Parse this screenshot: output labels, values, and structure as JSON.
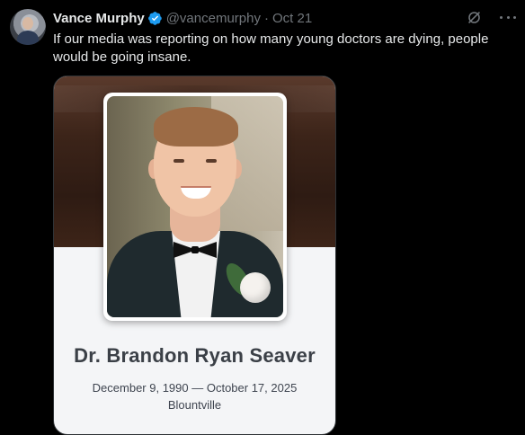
{
  "tweet": {
    "author_name": "Vance Murphy",
    "handle": "@vancemurphy",
    "separator": "·",
    "time": "Oct 21",
    "text": "If our media was reporting on how many young doctors are dying, people would be going insane.",
    "verified_icon": "verified-badge-icon",
    "grok_icon": "grok-icon",
    "more_icon": "more-options-icon"
  },
  "media": {
    "name": "Dr. Brandon Ryan Seaver",
    "dates": "December 9, 1990 — October 17, 2025",
    "place": "Blountville"
  },
  "colors": {
    "background": "#000000",
    "text": "#e7e9ea",
    "muted": "#71767b",
    "verified": "#1d9bf0"
  }
}
